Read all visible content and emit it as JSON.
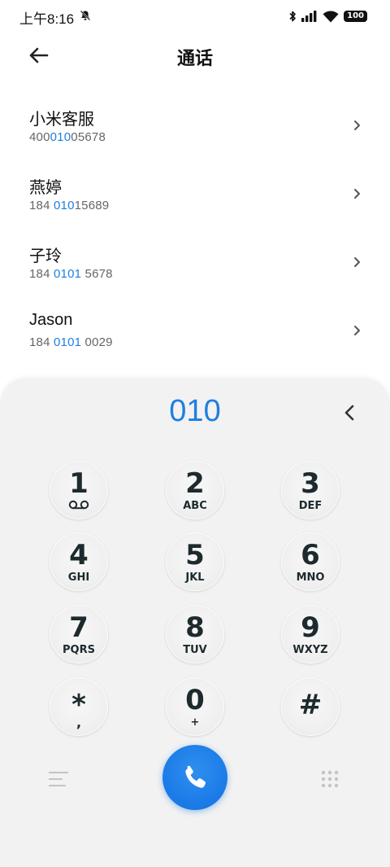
{
  "status_bar": {
    "time": "上午8:16",
    "battery": "100"
  },
  "header": {
    "title": "通话"
  },
  "contacts": [
    {
      "name": "小米客服",
      "number_pre": "400",
      "number_match": "010",
      "number_post": "05678"
    },
    {
      "name": "燕婷",
      "number_pre": "184 ",
      "number_match": "010",
      "number_post": "15689"
    },
    {
      "name": "子玲",
      "number_pre": "184 ",
      "number_match": "0101",
      "number_post": " 5678"
    },
    {
      "name": "Jason",
      "number_pre": "184 ",
      "number_match": "0101",
      "number_post": " 0029"
    }
  ],
  "dialer": {
    "input": "010",
    "keys": [
      {
        "digit": "1",
        "letters": ""
      },
      {
        "digit": "2",
        "letters": "ABC"
      },
      {
        "digit": "3",
        "letters": "DEF"
      },
      {
        "digit": "4",
        "letters": "GHI"
      },
      {
        "digit": "5",
        "letters": "JKL"
      },
      {
        "digit": "6",
        "letters": "MNO"
      },
      {
        "digit": "7",
        "letters": "PQRS"
      },
      {
        "digit": "8",
        "letters": "TUV"
      },
      {
        "digit": "9",
        "letters": "WXYZ"
      },
      {
        "digit": "*",
        "letters": ","
      },
      {
        "digit": "0",
        "letters": "+"
      },
      {
        "digit": "#",
        "letters": ""
      }
    ]
  },
  "colors": {
    "accent": "#1e7fe0",
    "panel": "#f2f2f2",
    "key_text": "#1d2a2e"
  },
  "icons": [
    "back-arrow-icon",
    "chevron-right-icon",
    "backspace-icon",
    "voicemail-icon",
    "menu-icon",
    "dialpad-icon",
    "phone-icon",
    "bell-muted-icon",
    "bluetooth-icon",
    "signal-icon",
    "wifi-icon"
  ]
}
